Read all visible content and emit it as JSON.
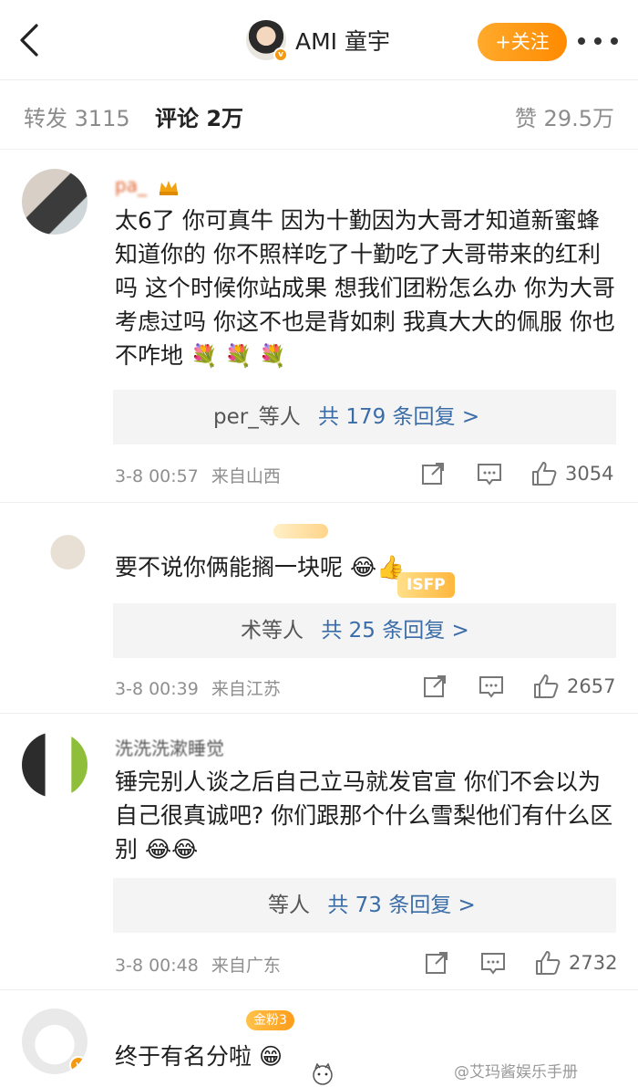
{
  "header": {
    "username": "AMI 童宇",
    "follow_label": "+关注",
    "colors": {
      "accent": "#ff8a00",
      "link": "#3a6da8"
    }
  },
  "tabs": {
    "repost": "转发 3115",
    "comment": "评论 2万",
    "like": "赞 29.5万"
  },
  "comments": [
    {
      "name": "pa_",
      "text": "太6了 你可真牛  因为十勤因为大哥才知道新蜜蜂  知道你的 你不照样吃了十勤吃了大哥带来的红利吗   这个时候你站成果 想我们团粉怎么办 你为大哥考虑过吗   你这不也是背如刺 我真大大的佩服 你也不咋地",
      "reply_user": "per_等人",
      "reply_count": "共 179 条回复 >",
      "time": "3-8 00:57",
      "location": "来自山西",
      "likes": "3054"
    },
    {
      "name": "",
      "text": "要不说你俩能搁一块呢",
      "reply_user": "术等人",
      "reply_count": "共 25 条回复 >",
      "time": "3-8 00:39",
      "location": "来自江苏",
      "likes": "2657"
    },
    {
      "name": "洗洗洗漱睡觉",
      "text": "锤完别人谈之后自己立马就发官宣 你们不会以为自己很真诚吧? 你们跟那个什么雪梨他们有什么区别",
      "reply_user": "等人",
      "reply_count": "共 73 条回复 >",
      "time": "3-8 00:48",
      "location": "来自广东",
      "likes": "2732"
    },
    {
      "name": "",
      "badge": "金粉3",
      "text": "终于有名分啦",
      "reply_user": "",
      "reply_count": "",
      "time": "",
      "location": "",
      "likes": ""
    }
  ],
  "badges": {
    "isfp": "ISFP"
  },
  "watermark": "@艾玛酱娱乐手册"
}
